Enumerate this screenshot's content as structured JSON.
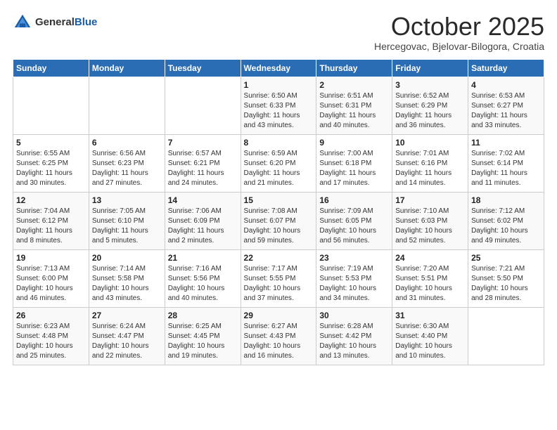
{
  "header": {
    "logo_general": "General",
    "logo_blue": "Blue",
    "month": "October 2025",
    "location": "Hercegovac, Bjelovar-Bilogora, Croatia"
  },
  "weekdays": [
    "Sunday",
    "Monday",
    "Tuesday",
    "Wednesday",
    "Thursday",
    "Friday",
    "Saturday"
  ],
  "weeks": [
    [
      {
        "day": "",
        "sunrise": "",
        "sunset": "",
        "daylight": ""
      },
      {
        "day": "",
        "sunrise": "",
        "sunset": "",
        "daylight": ""
      },
      {
        "day": "",
        "sunrise": "",
        "sunset": "",
        "daylight": ""
      },
      {
        "day": "1",
        "sunrise": "Sunrise: 6:50 AM",
        "sunset": "Sunset: 6:33 PM",
        "daylight": "Daylight: 11 hours and 43 minutes."
      },
      {
        "day": "2",
        "sunrise": "Sunrise: 6:51 AM",
        "sunset": "Sunset: 6:31 PM",
        "daylight": "Daylight: 11 hours and 40 minutes."
      },
      {
        "day": "3",
        "sunrise": "Sunrise: 6:52 AM",
        "sunset": "Sunset: 6:29 PM",
        "daylight": "Daylight: 11 hours and 36 minutes."
      },
      {
        "day": "4",
        "sunrise": "Sunrise: 6:53 AM",
        "sunset": "Sunset: 6:27 PM",
        "daylight": "Daylight: 11 hours and 33 minutes."
      }
    ],
    [
      {
        "day": "5",
        "sunrise": "Sunrise: 6:55 AM",
        "sunset": "Sunset: 6:25 PM",
        "daylight": "Daylight: 11 hours and 30 minutes."
      },
      {
        "day": "6",
        "sunrise": "Sunrise: 6:56 AM",
        "sunset": "Sunset: 6:23 PM",
        "daylight": "Daylight: 11 hours and 27 minutes."
      },
      {
        "day": "7",
        "sunrise": "Sunrise: 6:57 AM",
        "sunset": "Sunset: 6:21 PM",
        "daylight": "Daylight: 11 hours and 24 minutes."
      },
      {
        "day": "8",
        "sunrise": "Sunrise: 6:59 AM",
        "sunset": "Sunset: 6:20 PM",
        "daylight": "Daylight: 11 hours and 21 minutes."
      },
      {
        "day": "9",
        "sunrise": "Sunrise: 7:00 AM",
        "sunset": "Sunset: 6:18 PM",
        "daylight": "Daylight: 11 hours and 17 minutes."
      },
      {
        "day": "10",
        "sunrise": "Sunrise: 7:01 AM",
        "sunset": "Sunset: 6:16 PM",
        "daylight": "Daylight: 11 hours and 14 minutes."
      },
      {
        "day": "11",
        "sunrise": "Sunrise: 7:02 AM",
        "sunset": "Sunset: 6:14 PM",
        "daylight": "Daylight: 11 hours and 11 minutes."
      }
    ],
    [
      {
        "day": "12",
        "sunrise": "Sunrise: 7:04 AM",
        "sunset": "Sunset: 6:12 PM",
        "daylight": "Daylight: 11 hours and 8 minutes."
      },
      {
        "day": "13",
        "sunrise": "Sunrise: 7:05 AM",
        "sunset": "Sunset: 6:10 PM",
        "daylight": "Daylight: 11 hours and 5 minutes."
      },
      {
        "day": "14",
        "sunrise": "Sunrise: 7:06 AM",
        "sunset": "Sunset: 6:09 PM",
        "daylight": "Daylight: 11 hours and 2 minutes."
      },
      {
        "day": "15",
        "sunrise": "Sunrise: 7:08 AM",
        "sunset": "Sunset: 6:07 PM",
        "daylight": "Daylight: 10 hours and 59 minutes."
      },
      {
        "day": "16",
        "sunrise": "Sunrise: 7:09 AM",
        "sunset": "Sunset: 6:05 PM",
        "daylight": "Daylight: 10 hours and 56 minutes."
      },
      {
        "day": "17",
        "sunrise": "Sunrise: 7:10 AM",
        "sunset": "Sunset: 6:03 PM",
        "daylight": "Daylight: 10 hours and 52 minutes."
      },
      {
        "day": "18",
        "sunrise": "Sunrise: 7:12 AM",
        "sunset": "Sunset: 6:02 PM",
        "daylight": "Daylight: 10 hours and 49 minutes."
      }
    ],
    [
      {
        "day": "19",
        "sunrise": "Sunrise: 7:13 AM",
        "sunset": "Sunset: 6:00 PM",
        "daylight": "Daylight: 10 hours and 46 minutes."
      },
      {
        "day": "20",
        "sunrise": "Sunrise: 7:14 AM",
        "sunset": "Sunset: 5:58 PM",
        "daylight": "Daylight: 10 hours and 43 minutes."
      },
      {
        "day": "21",
        "sunrise": "Sunrise: 7:16 AM",
        "sunset": "Sunset: 5:56 PM",
        "daylight": "Daylight: 10 hours and 40 minutes."
      },
      {
        "day": "22",
        "sunrise": "Sunrise: 7:17 AM",
        "sunset": "Sunset: 5:55 PM",
        "daylight": "Daylight: 10 hours and 37 minutes."
      },
      {
        "day": "23",
        "sunrise": "Sunrise: 7:19 AM",
        "sunset": "Sunset: 5:53 PM",
        "daylight": "Daylight: 10 hours and 34 minutes."
      },
      {
        "day": "24",
        "sunrise": "Sunrise: 7:20 AM",
        "sunset": "Sunset: 5:51 PM",
        "daylight": "Daylight: 10 hours and 31 minutes."
      },
      {
        "day": "25",
        "sunrise": "Sunrise: 7:21 AM",
        "sunset": "Sunset: 5:50 PM",
        "daylight": "Daylight: 10 hours and 28 minutes."
      }
    ],
    [
      {
        "day": "26",
        "sunrise": "Sunrise: 6:23 AM",
        "sunset": "Sunset: 4:48 PM",
        "daylight": "Daylight: 10 hours and 25 minutes."
      },
      {
        "day": "27",
        "sunrise": "Sunrise: 6:24 AM",
        "sunset": "Sunset: 4:47 PM",
        "daylight": "Daylight: 10 hours and 22 minutes."
      },
      {
        "day": "28",
        "sunrise": "Sunrise: 6:25 AM",
        "sunset": "Sunset: 4:45 PM",
        "daylight": "Daylight: 10 hours and 19 minutes."
      },
      {
        "day": "29",
        "sunrise": "Sunrise: 6:27 AM",
        "sunset": "Sunset: 4:43 PM",
        "daylight": "Daylight: 10 hours and 16 minutes."
      },
      {
        "day": "30",
        "sunrise": "Sunrise: 6:28 AM",
        "sunset": "Sunset: 4:42 PM",
        "daylight": "Daylight: 10 hours and 13 minutes."
      },
      {
        "day": "31",
        "sunrise": "Sunrise: 6:30 AM",
        "sunset": "Sunset: 4:40 PM",
        "daylight": "Daylight: 10 hours and 10 minutes."
      },
      {
        "day": "",
        "sunrise": "",
        "sunset": "",
        "daylight": ""
      }
    ]
  ]
}
